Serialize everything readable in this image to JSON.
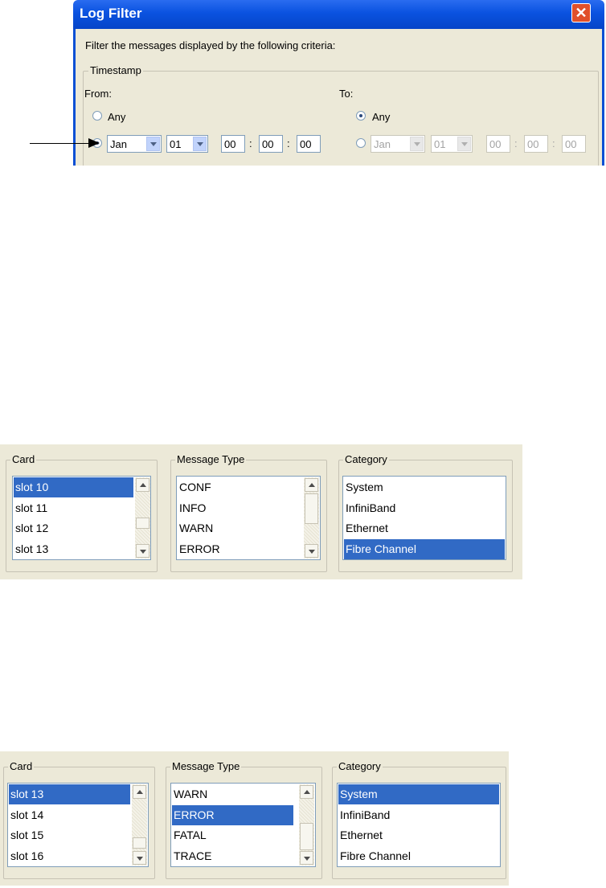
{
  "dialog": {
    "title": "Log Filter",
    "close_glyph": "✕",
    "description": "Filter the messages displayed by the following criteria:",
    "timestamp": {
      "legend": "Timestamp",
      "from": {
        "label": "From:",
        "any_label": "Any",
        "any_selected": false,
        "month": "Jan",
        "day": "01",
        "hour": "00",
        "minute": "00",
        "second": "00"
      },
      "to": {
        "label": "To:",
        "any_label": "Any",
        "any_selected": true,
        "month": "Jan",
        "day": "01",
        "hour": "00",
        "minute": "00",
        "second": "00"
      },
      "separator": ":"
    }
  },
  "panel1": {
    "card": {
      "legend": "Card",
      "items": [
        "slot 10",
        "slot 11",
        "slot 12",
        "slot 13"
      ],
      "selected": "slot 10"
    },
    "message_type": {
      "legend": "Message Type",
      "items": [
        "CONF",
        "INFO",
        "WARN",
        "ERROR"
      ],
      "selected": null
    },
    "category": {
      "legend": "Category",
      "items": [
        "System",
        "InfiniBand",
        "Ethernet",
        "Fibre Channel"
      ],
      "selected": "Fibre Channel"
    }
  },
  "panel2": {
    "card": {
      "legend": "Card",
      "items": [
        "slot 13",
        "slot 14",
        "slot 15",
        "slot 16"
      ],
      "selected": "slot 13"
    },
    "message_type": {
      "legend": "Message Type",
      "items": [
        "WARN",
        "ERROR",
        "FATAL",
        "TRACE"
      ],
      "selected": "ERROR"
    },
    "category": {
      "legend": "Category",
      "items": [
        "System",
        "InfiniBand",
        "Ethernet",
        "Fibre Channel"
      ],
      "selected": "System"
    }
  },
  "colors": {
    "title_bar": "#0a52e0",
    "selection": "#316ac5",
    "panel_bg": "#ece9d8"
  }
}
